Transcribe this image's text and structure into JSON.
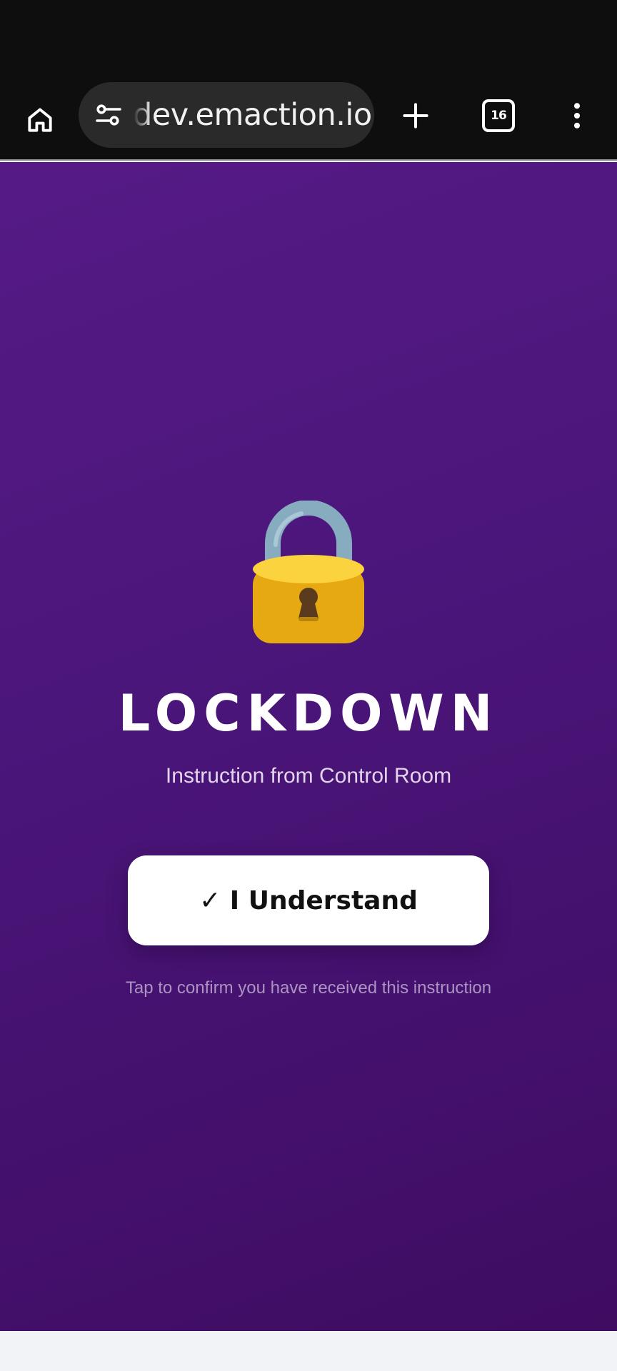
{
  "browser": {
    "url_text": "dev.emaction.io",
    "tab_count": "16",
    "icons": {
      "home": "home-icon",
      "site_settings": "tune-icon",
      "new_tab": "plus-icon",
      "tabs": "tab-switcher-icon",
      "menu": "more-vert-icon"
    }
  },
  "page": {
    "icon": "lock-icon",
    "title": "LOCKDOWN",
    "subtitle": "Instruction from Control Room",
    "confirm_button_label": "✓ I Understand",
    "hint": "Tap to confirm you have received this instruction"
  },
  "colors": {
    "background_top": "#561a86",
    "background_bottom": "#3f0c62",
    "button_bg": "#ffffff",
    "toolbar_bg": "#0e0e0e"
  }
}
